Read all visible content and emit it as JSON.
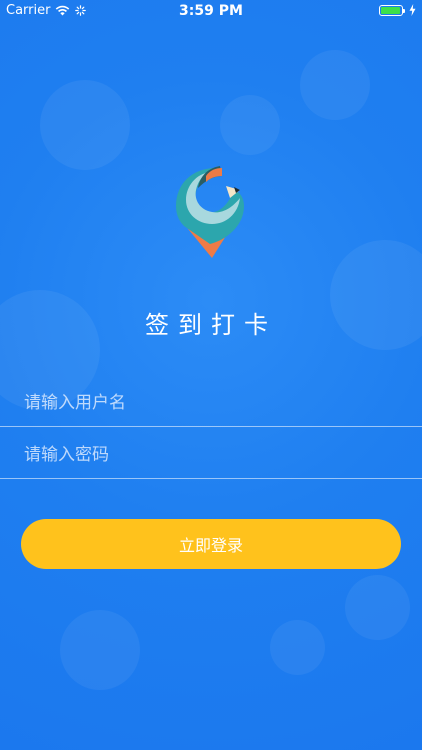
{
  "status_bar": {
    "carrier": "Carrier",
    "time": "3:59 PM",
    "icons": [
      "wifi-icon",
      "activity-icon",
      "battery-icon",
      "charging-icon"
    ],
    "battery_level": 0.95
  },
  "app": {
    "logo": "pencil-location-pin-logo",
    "title": "签到打卡"
  },
  "form": {
    "username_placeholder": "请输入用户名",
    "username_value": "",
    "password_placeholder": "请输入密码",
    "password_value": "",
    "submit_label": "立即登录"
  },
  "colors": {
    "background": "#1f7ff0",
    "button": "#ffc21c",
    "battery": "#3de04a",
    "logo_teal": "#2ca6ad",
    "logo_orange": "#ee7b46"
  }
}
